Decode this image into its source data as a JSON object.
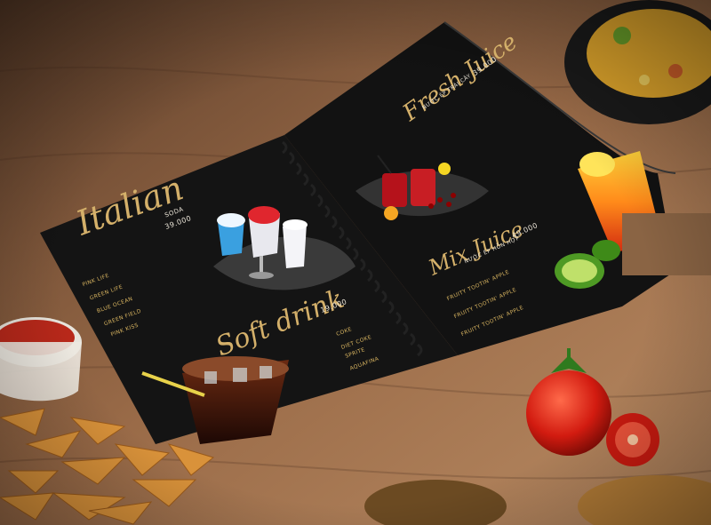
{
  "left_page": {
    "italian": {
      "title": "Italian",
      "subtitle": "SODA",
      "price": "39.000",
      "items": [
        "PINK LIFE",
        "GREEN LIFE",
        "BLUE OCEAN",
        "GREEN FIELD",
        "PINK KISS"
      ]
    },
    "soft_drink": {
      "title": "Soft drink",
      "price": "19.000",
      "items": [
        "COKE",
        "DIET COKE",
        "SPRITE",
        "AQUAFINA"
      ]
    }
  },
  "right_page": {
    "fresh_juice": {
      "title": "Fresh Juice",
      "subtitle": "NƯỚC ÉP TRÁI CÂY",
      "price": "39.000"
    },
    "mix_juice": {
      "title": "Mix Juice",
      "subtitle": "NƯỚC ÉP HỖN HỢP",
      "price": "49.000",
      "items": [
        "FRUITY TOOTIN' APPLE",
        "FRUITY TOOTIN' APPLE",
        "FRUITY TOOTIN' APPLE"
      ]
    }
  },
  "colors": {
    "table": "#8a5e3f",
    "menu_black": "#141414",
    "gold": "#d4b06a"
  }
}
